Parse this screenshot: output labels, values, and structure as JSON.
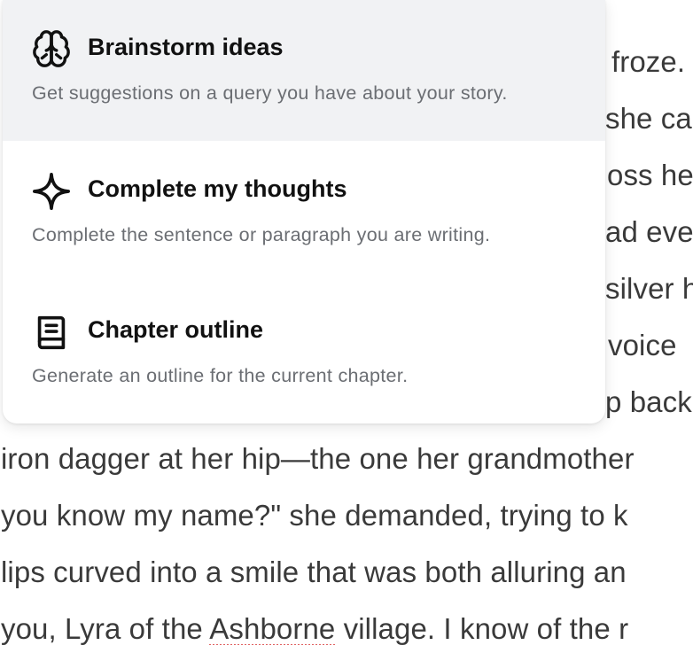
{
  "editor": {
    "lines": [
      " froze.",
      "she ca",
      "oss he",
      "ad eve",
      "silver h",
      "voice",
      "p back",
      "iron dagger at her hip—the one her grandmother",
      "you know my name?\" she demanded, trying to k",
      "lips curved into a smile that was both alluring an",
      "you, Lyra of the ",
      "Ashborne",
      " village. I know of the r"
    ]
  },
  "menu": {
    "items": [
      {
        "icon": "brain-icon",
        "title": "Brainstorm ideas",
        "description": "Get suggestions on a query you have about your story."
      },
      {
        "icon": "sparkle-icon",
        "title": "Complete my thoughts",
        "description": "Complete the sentence or paragraph you are writing."
      },
      {
        "icon": "book-icon",
        "title": "Chapter outline",
        "description": "Generate an outline for the current chapter."
      }
    ]
  }
}
